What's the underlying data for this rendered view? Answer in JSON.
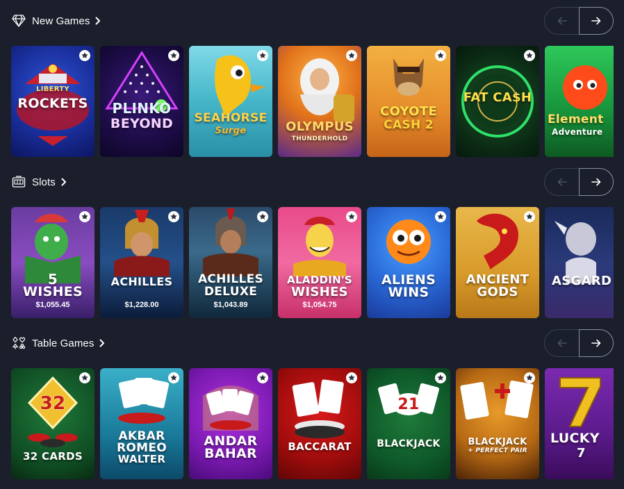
{
  "sections": {
    "new_games": {
      "title": "New Games",
      "icon": "diamond-icon",
      "games": [
        {
          "name_line1": "LIBERTY",
          "name_line2": "ROCKETS"
        },
        {
          "name_line1": "PLINKO",
          "name_line2": "BEYOND"
        },
        {
          "name_line1": "SEAHORSE",
          "name_line2": "Surge"
        },
        {
          "name_line1": "OLYMPUS",
          "name_line2": "THUNDERHOLD"
        },
        {
          "name_line1": "COYOTE",
          "name_line2": "CASH 2"
        },
        {
          "name_line1": "FAT CA$H",
          "name_line2": ""
        },
        {
          "name_line1": "Element",
          "name_line2": "Adventure"
        }
      ]
    },
    "slots": {
      "title": "Slots",
      "icon": "slot-machine-icon",
      "games": [
        {
          "name_line1": "5",
          "name_line2": "WISHES",
          "jackpot": "$1,055.45"
        },
        {
          "name_line1": "ACHILLES",
          "name_line2": "",
          "jackpot": "$1,228.00"
        },
        {
          "name_line1": "ACHILLES",
          "name_line2": "DELUXE",
          "jackpot": "$1,043.89"
        },
        {
          "name_line1": "ALADDIN'S",
          "name_line2": "WISHES",
          "jackpot": "$1,054.75"
        },
        {
          "name_line1": "ALIENS",
          "name_line2": "WINS",
          "jackpot": ""
        },
        {
          "name_line1": "ANCIENT",
          "name_line2": "GODS",
          "jackpot": ""
        },
        {
          "name_line1": "ASGARD",
          "name_line2": "",
          "jackpot": ""
        }
      ]
    },
    "table_games": {
      "title": "Table Games",
      "icon": "card-suits-icon",
      "games": [
        {
          "name_line1": "32",
          "name_line2": "32 CARDS"
        },
        {
          "name_line1": "AKBAR",
          "name_line2": "ROMEO",
          "name_line3": "WALTER"
        },
        {
          "name_line1": "ANDAR",
          "name_line2": "BAHAR"
        },
        {
          "name_line1": "BACCARAT",
          "name_line2": ""
        },
        {
          "name_line1": "BLACKJACK",
          "name_line2": "21"
        },
        {
          "name_line1": "BLACKJACK",
          "name_line2": "+ PERFECT PAIR"
        },
        {
          "name_line1": "LUCKY",
          "name_line2": "7"
        }
      ]
    }
  },
  "colors": {
    "background": "#1b1f2b",
    "text": "#ffffff",
    "nav_border": "#3a4050"
  }
}
